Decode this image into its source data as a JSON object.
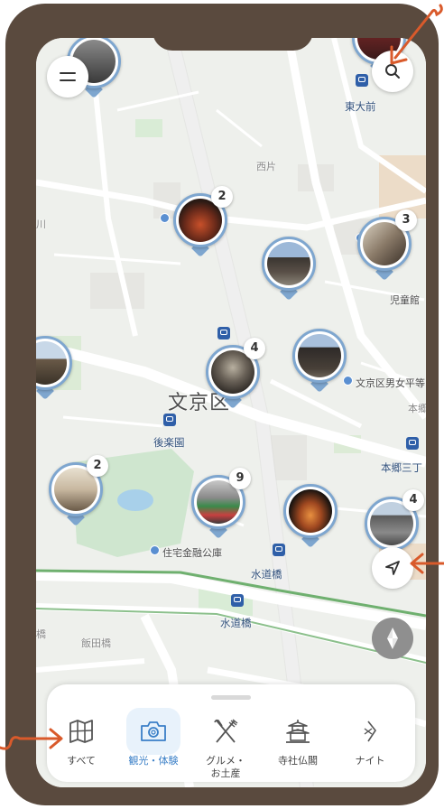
{
  "map": {
    "labels": {
      "todaimae": "東大前",
      "nishikata": "西片",
      "kawa": "川",
      "jidokan": "児童館",
      "bunkyo_ward": "文京区",
      "bunkyo_hall": "文京区男女平等",
      "hongo": "本郷",
      "korakuen": "後楽園",
      "hongo_sanchome": "本郷三丁",
      "sumitomo": "住宅金融公庫",
      "suidobashi_1": "水道橋",
      "suidobashi_2": "水道橋",
      "iidabashi": "飯田橋",
      "bashi": "橋"
    },
    "pins": [
      {
        "id": "pin-a",
        "count": "2"
      },
      {
        "id": "pin-b",
        "count": ""
      },
      {
        "id": "pin-c",
        "count": "3"
      },
      {
        "id": "pin-d",
        "count": ""
      },
      {
        "id": "pin-e",
        "count": "4"
      },
      {
        "id": "pin-f",
        "count": ""
      },
      {
        "id": "pin-g",
        "count": "2"
      },
      {
        "id": "pin-h",
        "count": "9"
      },
      {
        "id": "pin-i",
        "count": ""
      },
      {
        "id": "pin-j",
        "count": "4"
      }
    ]
  },
  "controls": {
    "menu_icon": "hamburger-icon",
    "search_icon": "search-icon",
    "location_icon": "navigation-arrow-icon",
    "compass_icon": "compass-icon"
  },
  "categories": [
    {
      "label": "すべて",
      "icon": "map-icon",
      "active": false
    },
    {
      "label": "観光・体験",
      "icon": "camera-icon",
      "active": true
    },
    {
      "label": "グルメ・\nお土産",
      "icon": "fork-knife-icon",
      "active": false
    },
    {
      "label": "寺社仏閣",
      "icon": "temple-icon",
      "active": false
    },
    {
      "label": "ナイト",
      "icon": "night-icon",
      "active": false
    }
  ],
  "colors": {
    "frame": "#5a4a3e",
    "annotation_arrow": "#d95a2b",
    "pin_border": "#7ea6cf",
    "active_category": "#3a7fc7"
  }
}
